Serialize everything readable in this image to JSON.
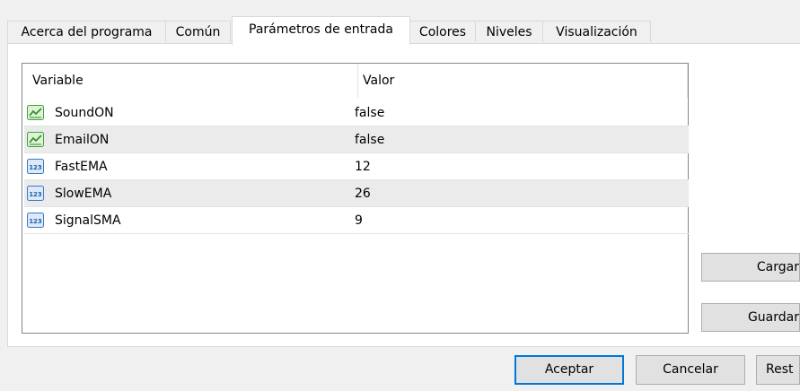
{
  "tabs": [
    {
      "label": "Acerca del programa"
    },
    {
      "label": "Común"
    },
    {
      "label": "Parámetros de entrada"
    },
    {
      "label": "Colores"
    },
    {
      "label": "Niveles"
    },
    {
      "label": "Visualización"
    }
  ],
  "active_tab": "Parámetros de entrada",
  "grid": {
    "headers": {
      "variable": "Variable",
      "value": "Valor"
    },
    "rows": [
      {
        "name": "SoundON",
        "value": "false",
        "icon": "boolean-icon"
      },
      {
        "name": "EmailON",
        "value": "false",
        "icon": "boolean-icon"
      },
      {
        "name": "FastEMA",
        "value": "12",
        "icon": "integer-icon"
      },
      {
        "name": "SlowEMA",
        "value": "26",
        "icon": "integer-icon"
      },
      {
        "name": "SignalSMA",
        "value": "9",
        "icon": "integer-icon"
      }
    ]
  },
  "side_buttons": {
    "load": "Cargar",
    "save": "Guardar"
  },
  "footer_buttons": {
    "accept": "Aceptar",
    "cancel": "Cancelar",
    "reset": "Rest"
  },
  "colors": {
    "focus": "#0078d7",
    "bool_icon": "#3fa33f",
    "int_icon": "#3a78c7"
  }
}
